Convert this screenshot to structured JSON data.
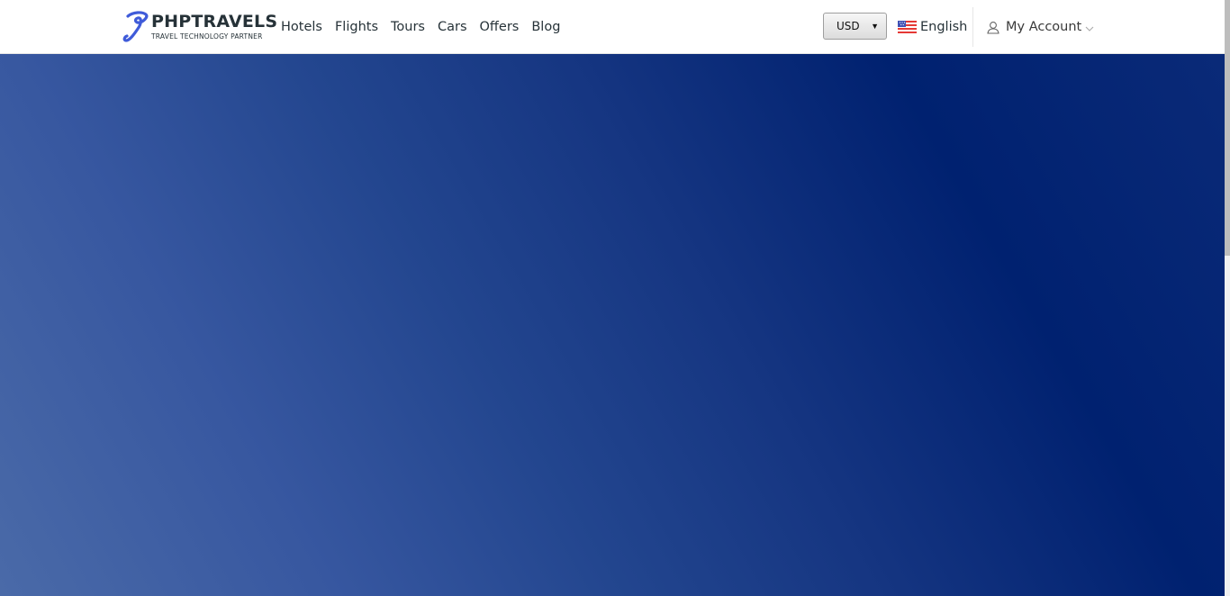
{
  "logo": {
    "title": "PHPTRAVELS",
    "subtitle": "TRAVEL TECHNOLOGY PARTNER",
    "icon": "phptravels-logo-icon",
    "accent": "#3f5bd9"
  },
  "nav": {
    "items": [
      {
        "label": "Hotels"
      },
      {
        "label": "Flights"
      },
      {
        "label": "Tours"
      },
      {
        "label": "Cars"
      },
      {
        "label": "Offers"
      },
      {
        "label": "Blog"
      }
    ]
  },
  "currency": {
    "selected": "USD",
    "icon": "caret-down-icon"
  },
  "language": {
    "label": "English",
    "icon": "us-flag-icon"
  },
  "account": {
    "label": "My Account",
    "icon": "user-icon",
    "caret_icon": "chevron-down-icon"
  },
  "colors": {
    "header_bg": "#ffffff",
    "hero_dark": "#002170",
    "hero_light": "#4a6aa8",
    "text": "#263238"
  }
}
